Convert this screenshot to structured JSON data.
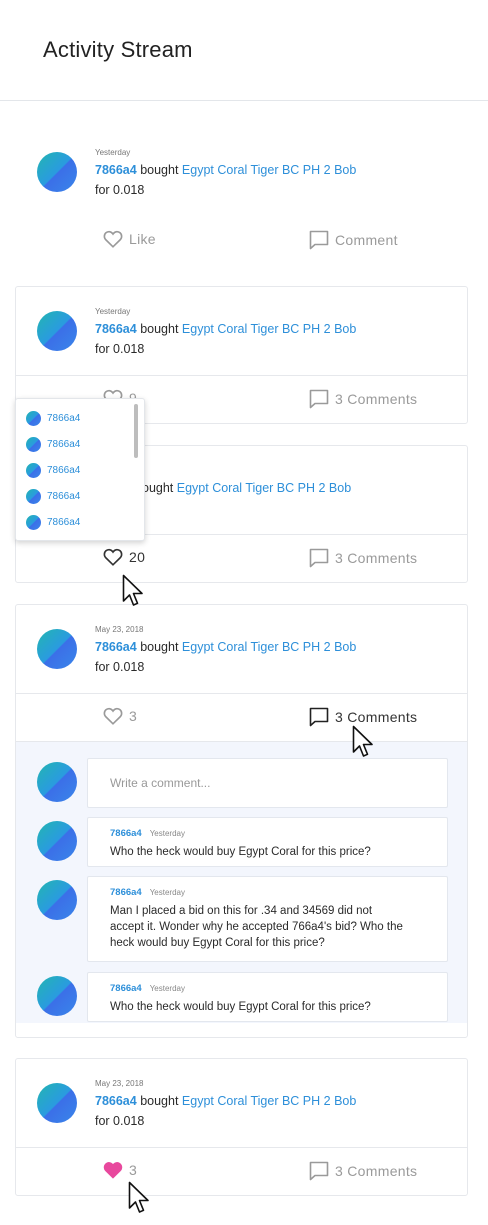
{
  "header": {
    "title": "Activity Stream"
  },
  "feed": [
    {
      "date": "Yesterday",
      "user": "7866a4",
      "verb": "bought",
      "item": "Egypt Coral Tiger BC PH 2 Bob",
      "price": "for 0.018",
      "like_label": "Like",
      "comment_label": "Comment"
    },
    {
      "date": "Yesterday",
      "user": "7866a4",
      "verb": "bought",
      "item": "Egypt Coral Tiger BC PH 2 Bob",
      "price": "for 0.018",
      "like_label": "9",
      "comment_label": "3 Comments"
    },
    {
      "verb": "ought",
      "item": "Egypt Coral Tiger BC PH 2 Bob",
      "like_label": "20",
      "comment_label": "3 Comments"
    },
    {
      "date": "May 23, 2018",
      "user": "7866a4",
      "verb": "bought",
      "item": "Egypt Coral Tiger BC PH 2 Bob",
      "price": "for 0.018",
      "like_label": "3",
      "comment_label": "3 Comments"
    },
    {
      "date": "May 23, 2018",
      "user": "7866a4",
      "verb": "bought",
      "item": "Egypt Coral Tiger BC PH 2 Bob",
      "price": "for 0.018",
      "like_label": "3",
      "comment_label": "3 Comments"
    }
  ],
  "likes_popup": {
    "users": [
      "7866a4",
      "7866a4",
      "7866a4",
      "7866a4",
      "7866a4"
    ]
  },
  "comments": {
    "input_placeholder": "Write a comment...",
    "items": [
      {
        "user": "7866a4",
        "time": "Yesterday",
        "text": "Who the heck would buy Egypt Coral for this price?"
      },
      {
        "user": "7866a4",
        "time": "Yesterday",
        "text": "Man I placed a bid on this for .34 and 34569 did not accept it. Wonder why he accepted 766a4's bid? Who the heck would buy Egypt Coral for this price?"
      },
      {
        "user": "7866a4",
        "time": "Yesterday",
        "text": "Who the heck would buy Egypt Coral for this price?"
      }
    ]
  },
  "colors": {
    "link": "#2d8fd9",
    "liked_heart": "#e8489d",
    "thread_bg": "#f3f6fd"
  },
  "icons": [
    "heart-icon",
    "comment-icon",
    "heart-filled-icon",
    "cursor-arrow-icon"
  ]
}
